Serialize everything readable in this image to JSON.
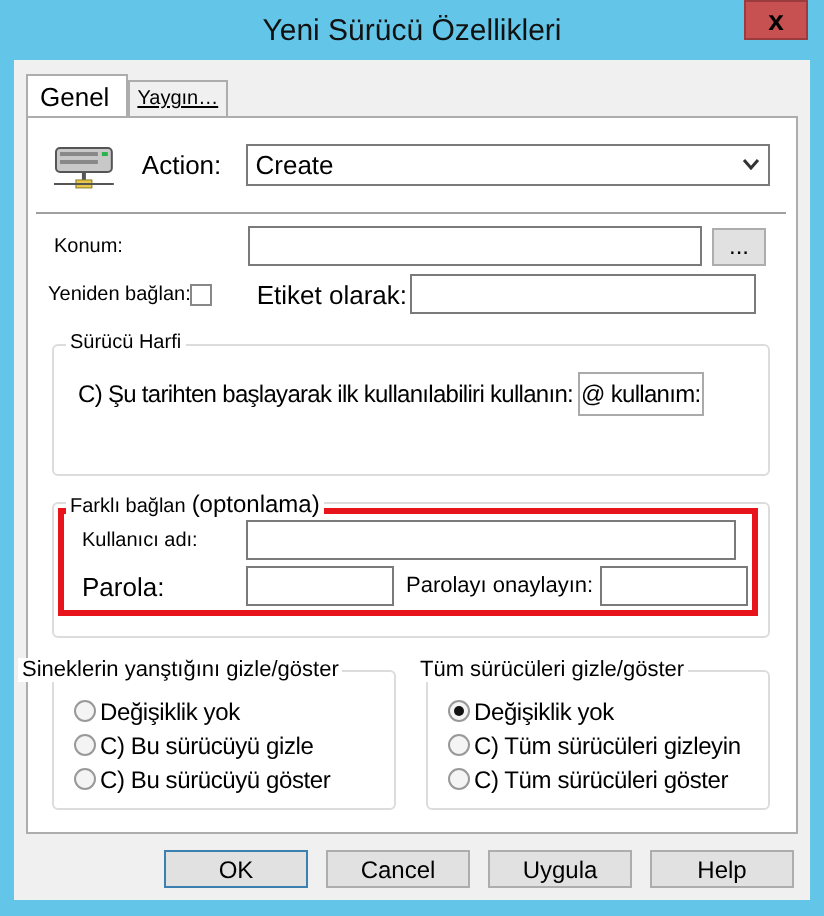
{
  "window": {
    "title": "Yeni Sürücü Özellikleri",
    "close": "x"
  },
  "tabs": [
    {
      "label": "Genel",
      "selected": true
    },
    {
      "label": "Yaygın…",
      "selected": false
    }
  ],
  "action": {
    "label": "Action:",
    "value": "Create"
  },
  "location": {
    "label": "Konum:",
    "browse": "..."
  },
  "reconnect": {
    "label": "Yeniden bağlan:",
    "checked": false
  },
  "label_as": {
    "label": "Etiket olarak:"
  },
  "drive_letter": {
    "title": "Sürücü Harfi",
    "text": "C) Şu tarihten başlayarak ilk kullanılabiliri kullanın:",
    "box": "@ kullanım:"
  },
  "connect_as": {
    "title": "Farklı bağlan",
    "note": "(optonlama)",
    "highlight": true,
    "user_label": "Kullanıcı adı:",
    "password_label": "Parola:",
    "confirm_label": "Parolayı onaylayın:"
  },
  "groups": [
    {
      "title": "Sineklerin yanştığını gizle/göster",
      "options": [
        {
          "label": "Değişiklik yok",
          "selected": false
        },
        {
          "label": "C) Bu sürücüyü gizle",
          "selected": false
        },
        {
          "label": "C) Bu sürücüyü göster",
          "selected": false
        }
      ]
    },
    {
      "title": "Tüm sürücüleri gizle/göster",
      "options": [
        {
          "label": "Değişiklik yok",
          "selected": true
        },
        {
          "label": "C) Tüm sürücüleri gizleyin",
          "selected": false
        },
        {
          "label": "C) Tüm sürücüleri göster",
          "selected": false
        }
      ]
    }
  ],
  "buttons": [
    {
      "label": "OK",
      "focused": true
    },
    {
      "label": "Cancel",
      "focused": false
    },
    {
      "label": "Uygula",
      "focused": false
    },
    {
      "label": "Help",
      "focused": false
    }
  ]
}
